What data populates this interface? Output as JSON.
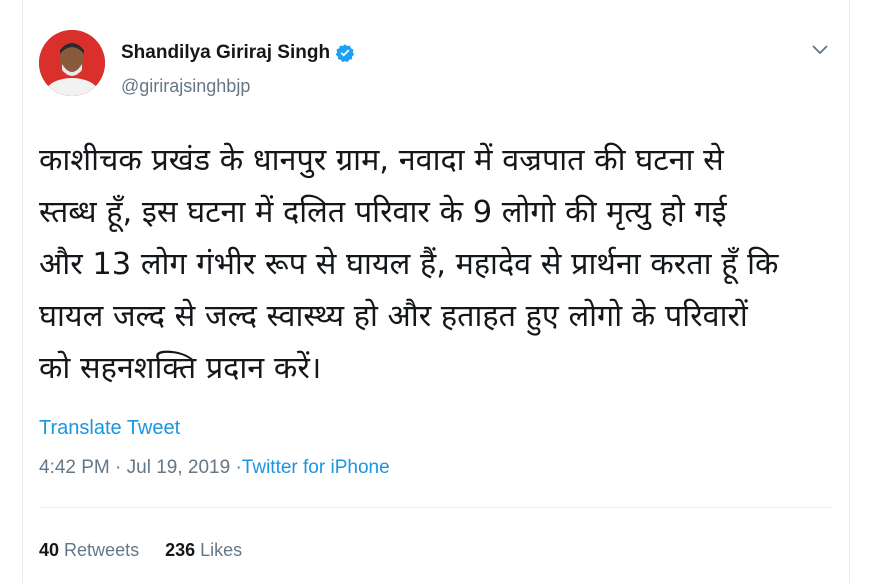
{
  "tweet": {
    "author": {
      "display_name": "Shandilya Giriraj Singh",
      "handle": "@girirajsinghbjp",
      "verified": true
    },
    "text": "काशीचक प्रखंड के धानपुर ग्राम, नवादा में वज्रपात की घटना से\nस्तब्ध हूँ, इस घटना में दलित परिवार के 9 लोगो की मृत्यु हो गई\nऔर 13 लोग गंभीर रूप से घायल हैं, महादेव से प्रार्थना करता हूँ कि\nघायल जल्द से जल्द स्वास्थ्य हो और हताहत हुए लोगो के परिवारों\nको सहनशक्ति प्रदान करें।",
    "translate_label": "Translate Tweet",
    "time": "4:42 PM",
    "separator": "·",
    "date": "Jul 19, 2019",
    "source": "Twitter for iPhone",
    "retweets": {
      "count": "40",
      "label": "Retweets"
    },
    "likes": {
      "count": "236",
      "label": "Likes"
    }
  },
  "icons": {
    "verified": "verified-badge-icon",
    "caret": "chevron-down-icon"
  },
  "colors": {
    "link": "#1b95e0",
    "muted": "#657786",
    "text": "#14171a",
    "avatar_bg": "#d9302c"
  }
}
